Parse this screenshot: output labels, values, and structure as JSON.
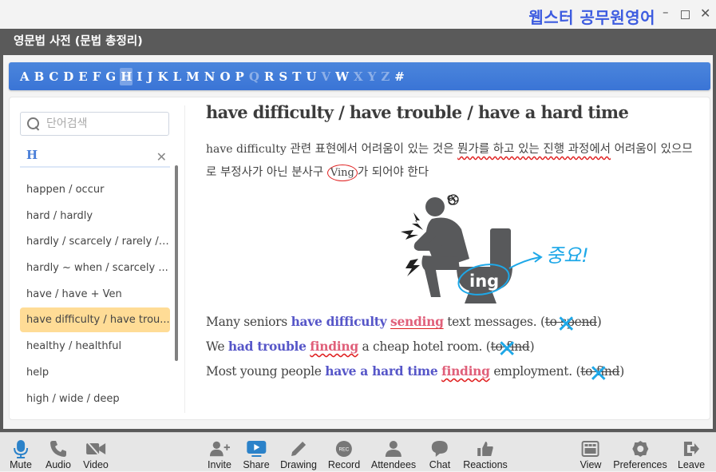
{
  "window": {
    "brand": "웹스터 공무원영어",
    "controls": {
      "minimize": "–",
      "close": "✕"
    }
  },
  "app": {
    "title": "영문법 사전 (문법 총정리)",
    "alphabet": [
      {
        "letter": "A",
        "state": "enabled"
      },
      {
        "letter": "B",
        "state": "enabled"
      },
      {
        "letter": "C",
        "state": "enabled"
      },
      {
        "letter": "D",
        "state": "enabled"
      },
      {
        "letter": "E",
        "state": "enabled"
      },
      {
        "letter": "F",
        "state": "enabled"
      },
      {
        "letter": "G",
        "state": "enabled"
      },
      {
        "letter": "H",
        "state": "active"
      },
      {
        "letter": "I",
        "state": "enabled"
      },
      {
        "letter": "J",
        "state": "enabled"
      },
      {
        "letter": "K",
        "state": "enabled"
      },
      {
        "letter": "L",
        "state": "enabled"
      },
      {
        "letter": "M",
        "state": "enabled"
      },
      {
        "letter": "N",
        "state": "enabled"
      },
      {
        "letter": "O",
        "state": "enabled"
      },
      {
        "letter": "P",
        "state": "enabled"
      },
      {
        "letter": "Q",
        "state": "disabled"
      },
      {
        "letter": "R",
        "state": "enabled"
      },
      {
        "letter": "S",
        "state": "enabled"
      },
      {
        "letter": "T",
        "state": "enabled"
      },
      {
        "letter": "U",
        "state": "enabled"
      },
      {
        "letter": "V",
        "state": "disabled"
      },
      {
        "letter": "W",
        "state": "enabled"
      },
      {
        "letter": "X",
        "state": "disabled"
      },
      {
        "letter": "Y",
        "state": "disabled"
      },
      {
        "letter": "Z",
        "state": "disabled"
      },
      {
        "letter": "#",
        "state": "enabled"
      }
    ],
    "sidebar": {
      "search_placeholder": "단어검색",
      "search_value": "",
      "current_letter": "H",
      "clear_label": "✕",
      "items": [
        {
          "label": "happen / occur",
          "selected": false
        },
        {
          "label": "hard / hardly",
          "selected": false
        },
        {
          "label": "hardly / scarcely / rarely / ...",
          "selected": false
        },
        {
          "label": "hardly ~ when / scarcely ...",
          "selected": false
        },
        {
          "label": "have / have + Ven",
          "selected": false
        },
        {
          "label": "have difficulty / have trou...",
          "selected": true
        },
        {
          "label": "healthy / healthful",
          "selected": false
        },
        {
          "label": "help",
          "selected": false
        },
        {
          "label": "high / wide / deep",
          "selected": false
        }
      ]
    },
    "content": {
      "title": "have difficulty / have trouble / have a hard time",
      "desc": {
        "part1_en": "have difficulty",
        "part2": " 관련 표현에서 어려움이 있는 것은 ",
        "part3_highlight": "뭔가를 하고 있는 진행 과정에서",
        "part4": " 어려움이 있으므로 부정사가 아닌 분사구 ",
        "part5_circled": "Ving",
        "part6": "가 되어야 한다"
      },
      "figure": {
        "badge": "ing",
        "annotation": "중요!"
      },
      "examples": [
        {
          "pre": "Many seniors ",
          "kw": "have difficulty",
          "ving": "sending",
          "post": " text messages. (",
          "wrong": "to spend",
          "close": ")"
        },
        {
          "pre": "We ",
          "kw": "had trouble",
          "ving": "finding",
          "post": " a cheap hotel room. (",
          "wrong": "to find",
          "close": ")"
        },
        {
          "pre": "Most young people ",
          "kw": "have a hard time",
          "ving": "finding",
          "post": " employment. (",
          "wrong": "to find",
          "close": ")"
        }
      ],
      "cross_mark": "✕"
    }
  },
  "toolbar": {
    "left": [
      {
        "label": "Mute",
        "icon": "microphone-icon",
        "color": "#2b82c9"
      },
      {
        "label": "Audio",
        "icon": "phone-icon",
        "color": "#777777"
      },
      {
        "label": "Video",
        "icon": "video-camera-off-icon",
        "color": "#777777"
      }
    ],
    "center": [
      {
        "label": "Invite",
        "icon": "add-user-icon",
        "color": "#777777"
      },
      {
        "label": "Share",
        "icon": "share-screen-icon",
        "color": "#2b82c9"
      },
      {
        "label": "Drawing",
        "icon": "pencil-icon",
        "color": "#777777"
      },
      {
        "label": "Record",
        "icon": "record-icon",
        "color": "#777777",
        "badge": "REC"
      },
      {
        "label": "Attendees",
        "icon": "attendees-icon",
        "color": "#777777"
      },
      {
        "label": "Chat",
        "icon": "chat-bubble-icon",
        "color": "#777777"
      },
      {
        "label": "Reactions",
        "icon": "thumbs-up-icon",
        "color": "#777777"
      }
    ],
    "right": [
      {
        "label": "View",
        "icon": "view-layout-icon",
        "color": "#777777"
      },
      {
        "label": "Preferences",
        "icon": "gear-icon",
        "color": "#777777"
      },
      {
        "label": "Leave",
        "icon": "leave-door-icon",
        "color": "#777777"
      }
    ]
  }
}
